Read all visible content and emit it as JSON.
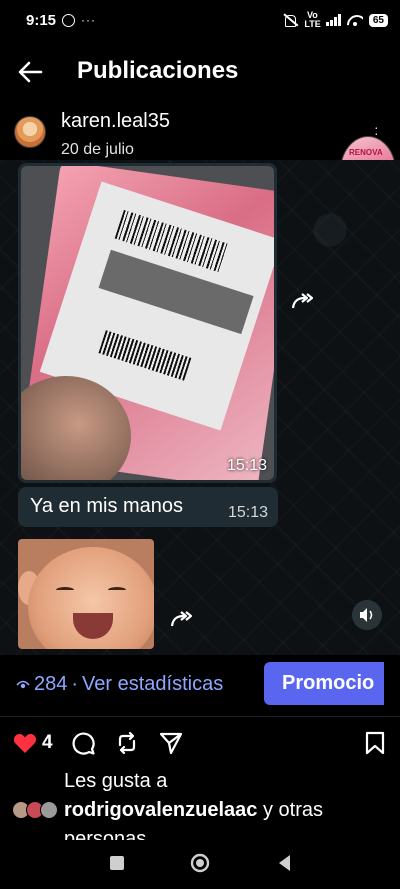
{
  "status_bar": {
    "time": "9:15",
    "dots": "···",
    "network": "Vo LTE",
    "battery": "65"
  },
  "header": {
    "title": "Publicaciones",
    "back_icon": "arrow-left-icon"
  },
  "post": {
    "username": "karen.leal35",
    "date": "20 de julio",
    "messages": [
      {
        "type": "photo",
        "time": "15:13"
      },
      {
        "type": "text",
        "text": "Ya en mis manos",
        "time": "15:13"
      },
      {
        "type": "photo",
        "time": ""
      }
    ],
    "views": "284",
    "separator": "·",
    "stats_label": "Ver estadísticas",
    "promote_label": "Promocio",
    "like_count": "4",
    "likes_label": "Les gusta a",
    "liked_by_user": "rodrigovalenzuelaac",
    "liked_by_suffix": " y otras",
    "liked_by_continuation": "personas"
  },
  "colors": {
    "accent": "#5b66f0",
    "link": "#8ea7ff",
    "like": "#ff3040",
    "bubble": "#202c33"
  },
  "icons": [
    "arrow-left-icon",
    "heart-icon",
    "comment-icon",
    "repost-icon",
    "share-icon",
    "bookmark-icon",
    "forward-icon",
    "eye-icon",
    "speaker-icon",
    "home-circle-icon",
    "recents-square-icon",
    "back-triangle-icon"
  ]
}
